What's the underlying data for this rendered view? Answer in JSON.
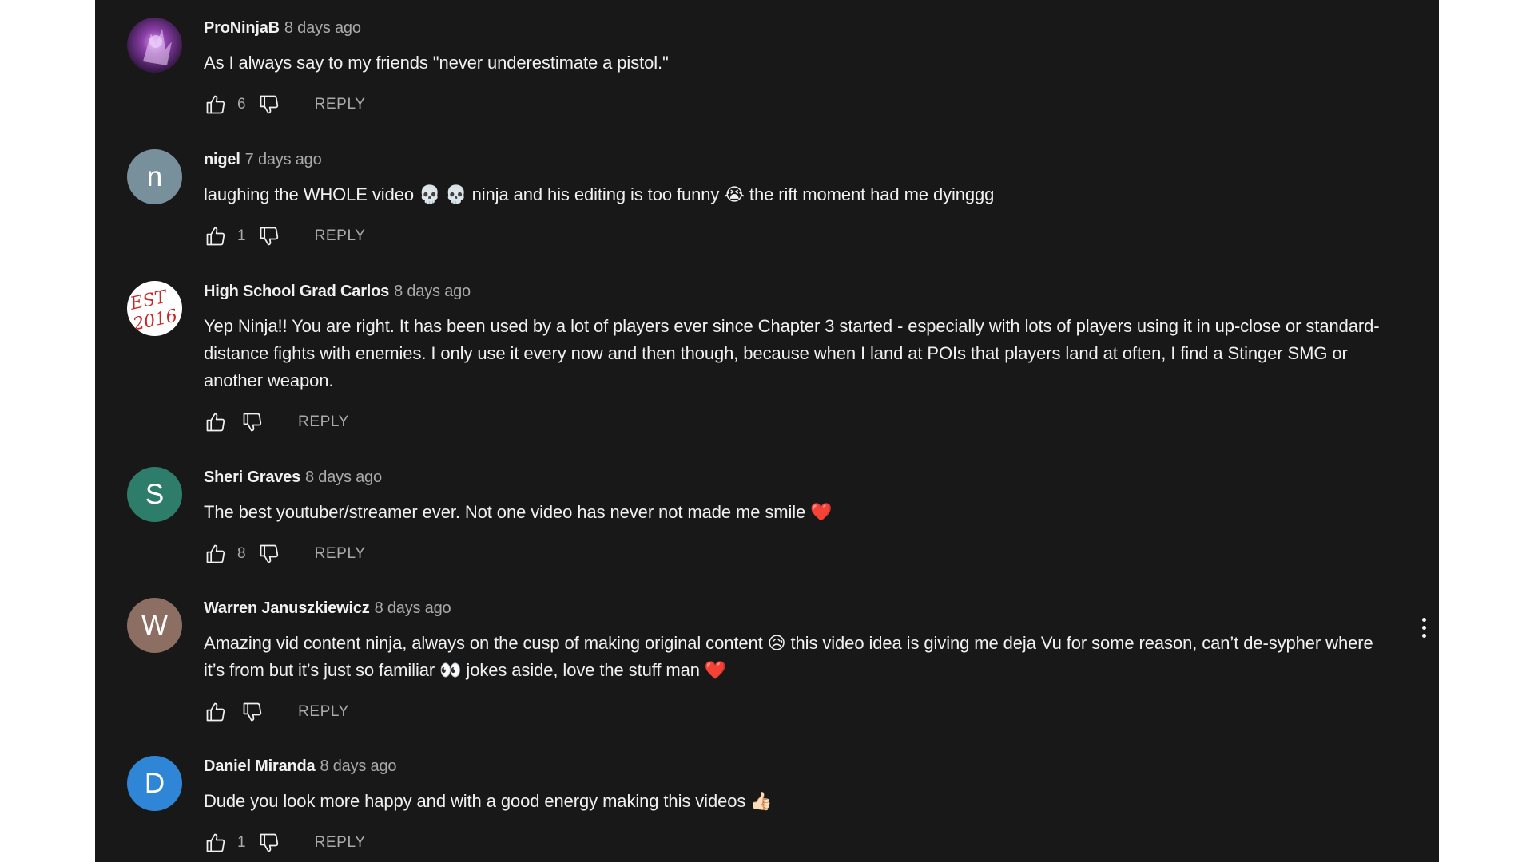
{
  "reply_label": "REPLY",
  "icons": {
    "like": "thumbs-up-icon",
    "dislike": "thumbs-down-icon",
    "more": "more-vertical-icon"
  },
  "comments": [
    {
      "author": "ProNinjaB",
      "time": "8 days ago",
      "text": "As I always say to my friends \"never underestimate a pistol.\"",
      "likes": "6",
      "avatar_letter": "",
      "avatar_color": "#5a2a6e"
    },
    {
      "author": "nigel",
      "time": "7 days ago",
      "text": "laughing the WHOLE video 💀 💀 ninja and his editing is too funny 😭 the rift moment had me dyinggg",
      "likes": "1",
      "avatar_letter": "n",
      "avatar_color": "#78909c"
    },
    {
      "author": "High School Grad Carlos",
      "time": "8 days ago",
      "text": "Yep Ninja!! You are right. It has been used by a lot of players ever since Chapter 3 started - especially with lots of players using it in up-close or standard-distance fights with enemies. I only use it every now and then though, because when I land at POIs that players land at often, I find a Stinger SMG or another weapon.",
      "likes": "",
      "avatar_letter": "",
      "avatar_color": "#ffffff",
      "avatar_text": "EST 2016"
    },
    {
      "author": "Sheri Graves",
      "time": "8 days ago",
      "text": "The best youtuber/streamer ever. Not one video has never not made me smile ❤️",
      "likes": "8",
      "avatar_letter": "S",
      "avatar_color": "#2e7d6b"
    },
    {
      "author": "Warren Januszkiewicz",
      "time": "8 days ago",
      "text": "Amazing vid content ninja, always on the cusp of making original content 😥 this video idea is giving me deja Vu for some reason, can’t de-sypher where it’s from but it’s just so familiar 👀 jokes aside, love the stuff man ❤️",
      "likes": "",
      "avatar_letter": "W",
      "avatar_color": "#8d6e63"
    },
    {
      "author": "Daniel Miranda",
      "time": "8 days ago",
      "text": "Dude you look more happy and with a good energy making this videos 👍🏻",
      "likes": "1",
      "avatar_letter": "D",
      "avatar_color": "#2f86d6"
    }
  ]
}
